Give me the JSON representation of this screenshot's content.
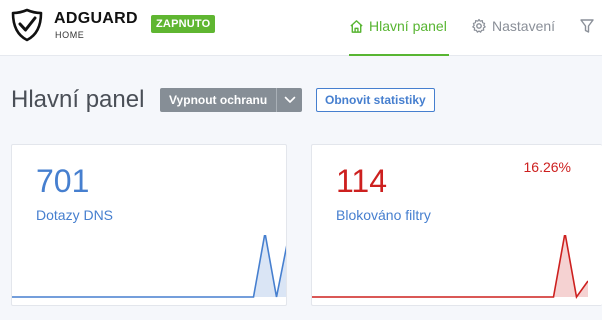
{
  "header": {
    "brand": "ADGUARD",
    "brand_sub": "HOME",
    "status_badge": "ZAPNUTO",
    "nav": {
      "dashboard": "Hlavní panel",
      "settings": "Nastavení"
    }
  },
  "main": {
    "title": "Hlavní panel",
    "disable_protection": "Vypnout ochranu",
    "refresh_statistics": "Obnovit statistiky"
  },
  "cards": {
    "dns_queries": {
      "value": "701",
      "label": "Dotazy DNS",
      "color": "#467fcf",
      "series": [
        0,
        0,
        0,
        0,
        0,
        0,
        0,
        0,
        0,
        0,
        0,
        0,
        0,
        0,
        0,
        0,
        0,
        0,
        0,
        0,
        0,
        0,
        1,
        0,
        0.9
      ]
    },
    "blocked_by_filters": {
      "value": "114",
      "label": "Blokováno filtry",
      "percent": "16.26%",
      "color": "#cd201f",
      "series": [
        0,
        0,
        0,
        0,
        0,
        0,
        0,
        0,
        0,
        0,
        0,
        0,
        0,
        0,
        0,
        0,
        0,
        0,
        0,
        0,
        0,
        0,
        1,
        0,
        0.25
      ]
    }
  },
  "colors": {
    "accent_green": "#5fb631",
    "link_blue": "#467fcf",
    "danger_red": "#cd201f"
  },
  "icons": [
    "adguard-shield-icon",
    "home-icon",
    "gear-icon",
    "filter-icon",
    "chevron-down-icon"
  ]
}
